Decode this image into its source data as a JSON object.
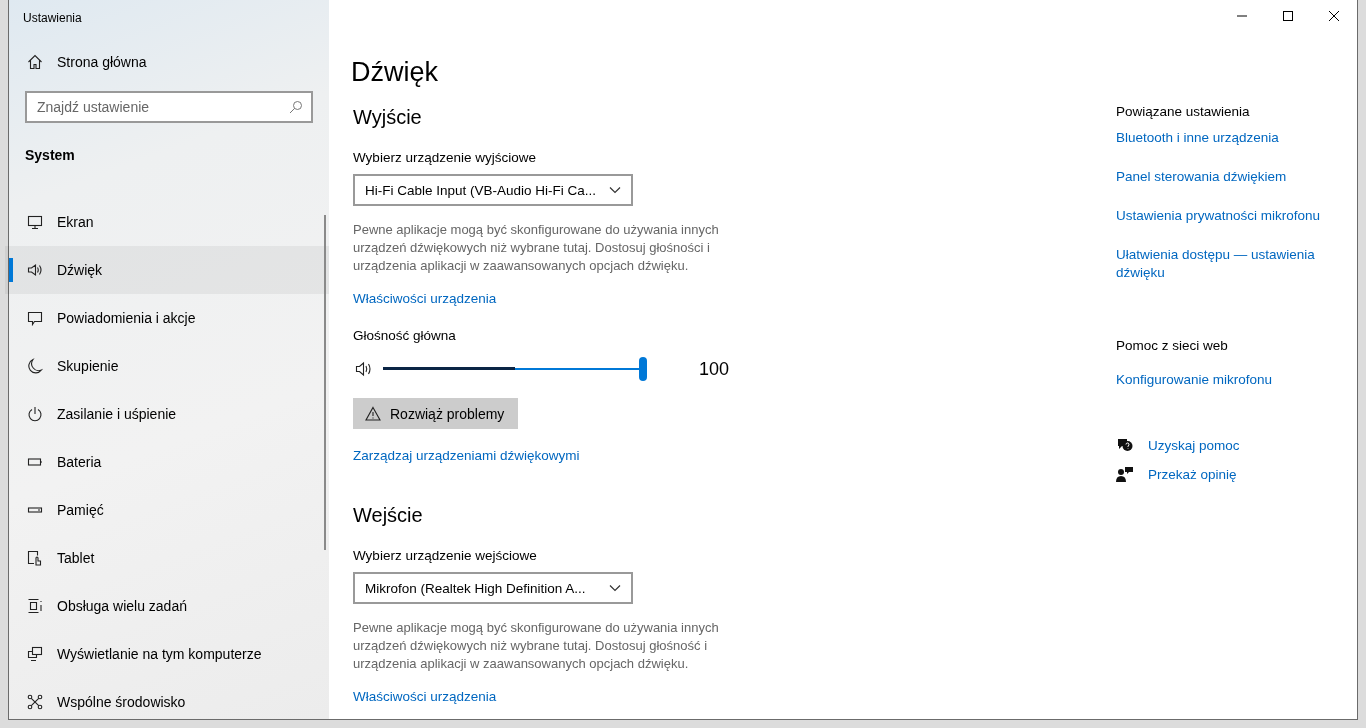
{
  "window": {
    "title": "Ustawienia"
  },
  "sidebar": {
    "home": "Strona główna",
    "search": {
      "placeholder": "Znajdź ustawienie"
    },
    "section": "System",
    "items": [
      {
        "label": "Ekran",
        "selected": false
      },
      {
        "label": "Dźwięk",
        "selected": true
      },
      {
        "label": "Powiadomienia i akcje",
        "selected": false
      },
      {
        "label": "Skupienie",
        "selected": false
      },
      {
        "label": "Zasilanie i uśpienie",
        "selected": false
      },
      {
        "label": "Bateria",
        "selected": false
      },
      {
        "label": "Pamięć",
        "selected": false
      },
      {
        "label": "Tablet",
        "selected": false
      },
      {
        "label": "Obsługa wielu zadań",
        "selected": false
      },
      {
        "label": "Wyświetlanie na tym komputerze",
        "selected": false
      },
      {
        "label": "Wspólne środowisko",
        "selected": false
      }
    ]
  },
  "page": {
    "title": "Dźwięk",
    "output": {
      "heading": "Wyjście",
      "device_label": "Wybierz urządzenie wyjściowe",
      "device": "Hi-Fi Cable Input (VB-Audio Hi-Fi Ca...",
      "description": "Pewne aplikacje mogą być skonfigurowane do używania innych urządzeń dźwiękowych niż wybrane tutaj. Dostosuj głośności i urządzenia aplikacji w zaawansowanych opcjach dźwięku.",
      "properties_link": "Właściwości urządzenia",
      "volume": {
        "label": "Głośność główna",
        "level": 1,
        "reading": "100",
        "meter": {
          "level": 0.5
        }
      },
      "troubleshoot_button": "Rozwiąż problemy",
      "manage_link": "Zarządzaj urządzeniami dźwiękowymi"
    },
    "input": {
      "heading": "Wejście",
      "device_label": "Wybierz urządzenie wejściowe",
      "device": "Mikrofon (Realtek High Definition A...",
      "description": "Pewne aplikacje mogą być skonfigurowane do używania innych urządzeń dźwiękowych niż wybrane tutaj. Dostosuj głośność i urządzenia aplikacji w zaawansowanych opcjach dźwięku.",
      "properties_link": "Właściwości urządzenia"
    }
  },
  "related": {
    "heading": "Powiązane ustawienia",
    "links": [
      "Bluetooth i inne urządzenia",
      "Panel sterowania dźwiękiem",
      "Ustawienia prywatności mikrofonu",
      "Ułatwienia dostępu — ustawienia dźwięku"
    ]
  },
  "web_help": {
    "heading": "Pomoc z sieci web",
    "links": [
      "Konfigurowanie mikrofonu"
    ]
  },
  "help_links": [
    {
      "kind": "help",
      "label": "Uzyskaj pomoc"
    },
    {
      "kind": "feedback",
      "label": "Przekaż opinię"
    }
  ]
}
